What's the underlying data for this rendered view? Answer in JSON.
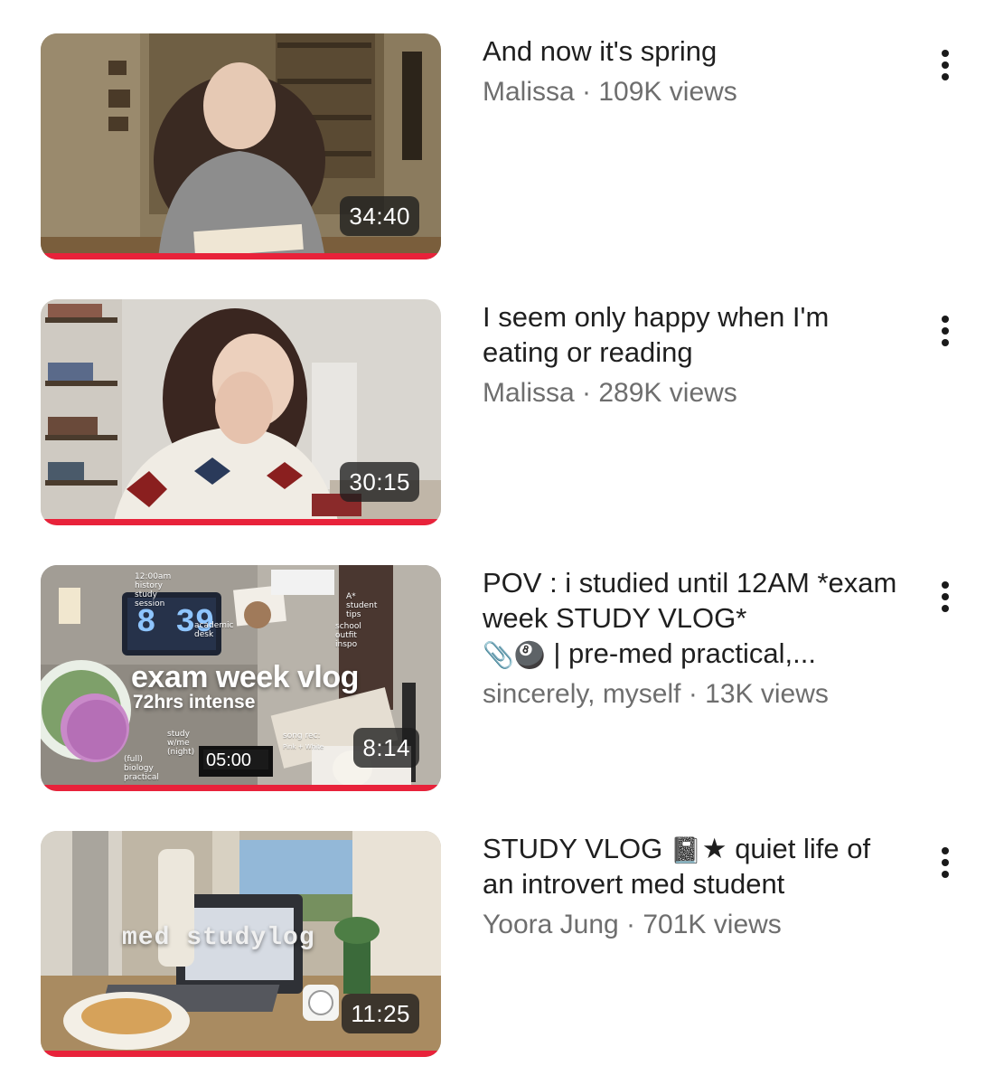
{
  "videos": [
    {
      "title": "And now it's spring",
      "channel": "Malissa",
      "views": "109K views",
      "duration": "34:40",
      "thumbnail_icon": "reading-girl-thumbnail"
    },
    {
      "title": "I seem only happy when I'm eating or reading",
      "channel": "Malissa",
      "views": "289K views",
      "duration": "30:15",
      "thumbnail_icon": "sweater-girl-thumbnail"
    },
    {
      "title": "POV : i studied until 12AM *exam week STUDY VLOG*",
      "title_suffix": "| pre-med practical,...",
      "channel": "sincerely, myself",
      "views": "13K views",
      "duration": "8:14",
      "thumbnail_text": {
        "headline": "exam week vlog",
        "subheadline": "72hrs intense",
        "clock": "8 39",
        "timer": "05:00",
        "note1": "12:00am history study session",
        "note2": "academic desk",
        "note3": "A* student tips",
        "note4": "school outfit inspo",
        "note5": "study w/me (night)",
        "note6": "(full) biology practical",
        "note7": "song rec:",
        "note8": "Pink + White"
      },
      "thumbnail_icon": "exam-week-thumbnail"
    },
    {
      "title": "STUDY VLOG",
      "title_rest": "quiet life of an introvert med student",
      "channel": "Yoora Jung",
      "views": "701K views",
      "duration": "11:25",
      "thumbnail_text": {
        "overlay": "med studylog"
      },
      "thumbnail_icon": "med-studylog-thumbnail"
    }
  ],
  "separator": " · ",
  "colors": {
    "progress": "#e8223a",
    "title": "#1f1f1f",
    "subtitle": "#6e6e6e"
  }
}
